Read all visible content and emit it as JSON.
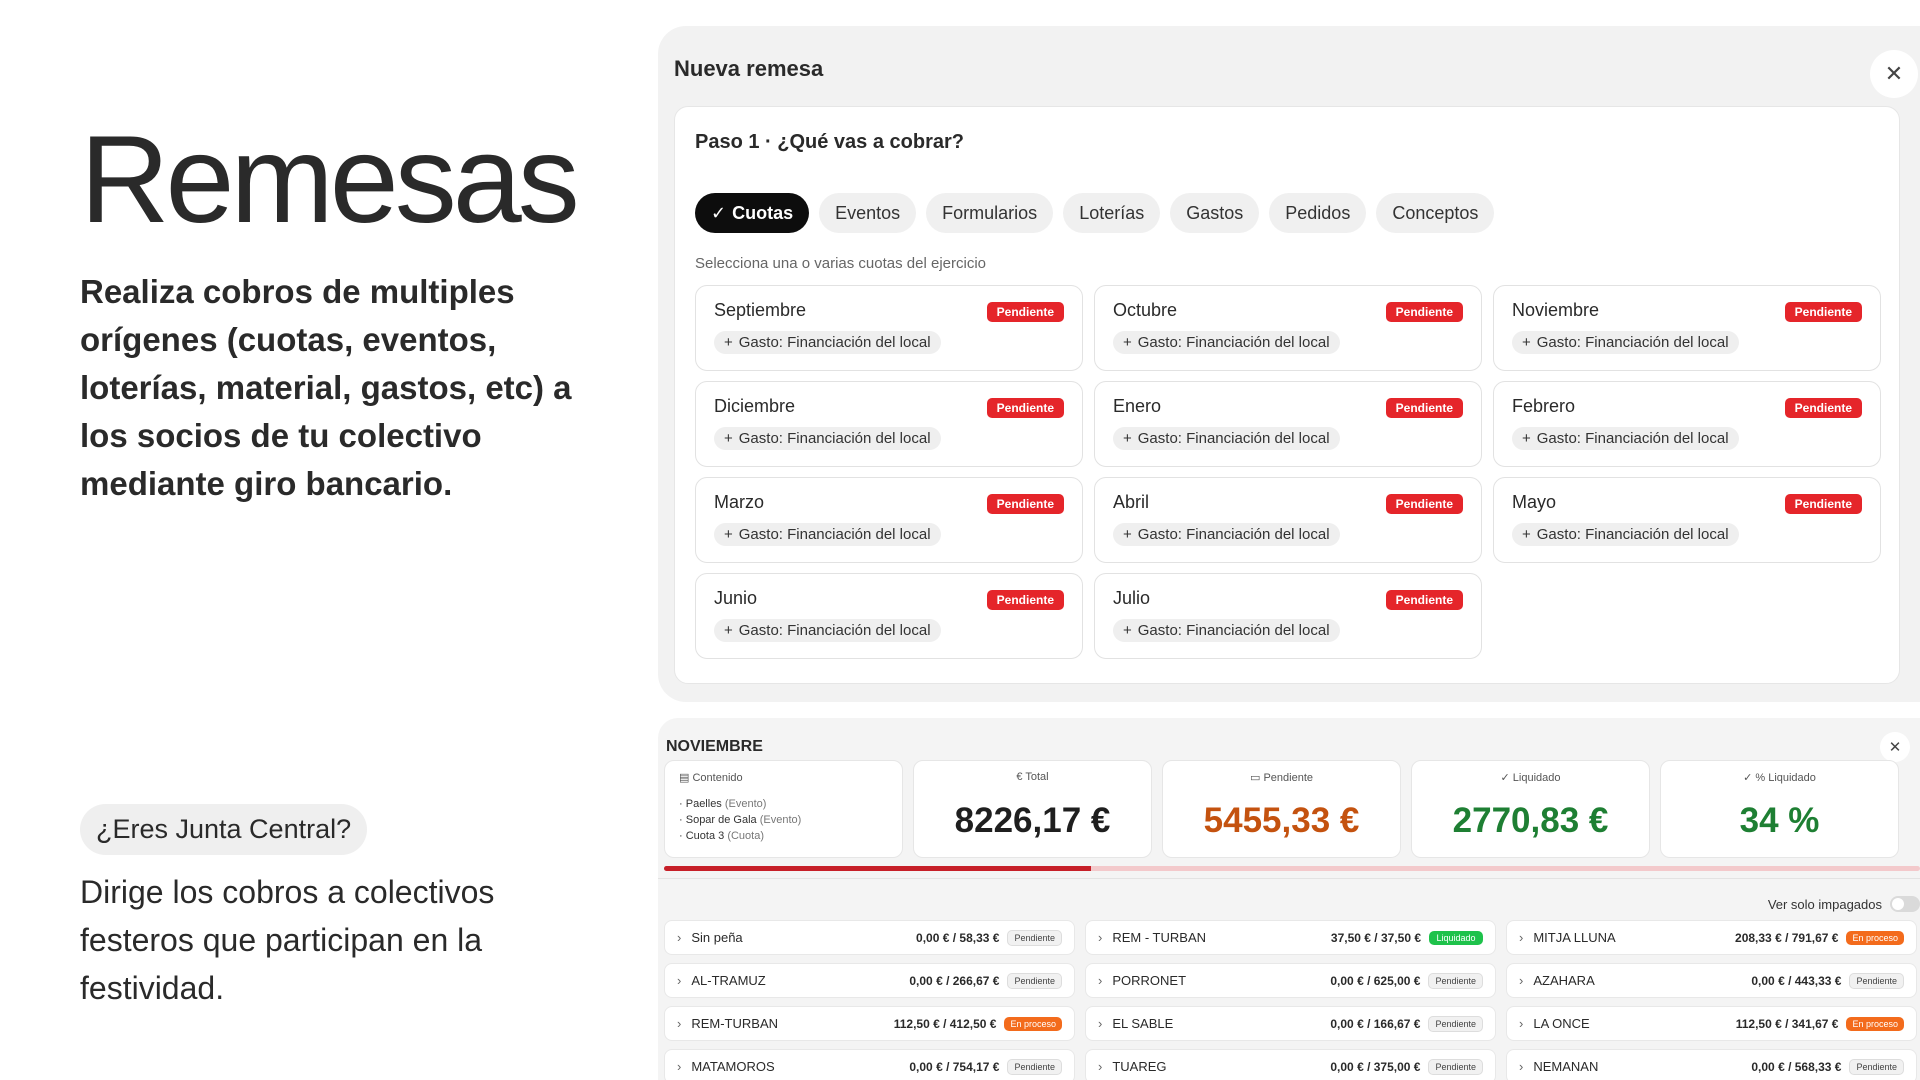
{
  "hero": {
    "title": "Remesas",
    "subtitle": "Realiza cobros de multiples orígenes (cuotas, eventos, loterías, material, gastos, etc) a los socios de tu colectivo mediante giro bancario.",
    "junta_pill": "¿Eres Junta Central?",
    "junta_desc": "Dirige los cobros a colectivos festeros que participan en la festividad."
  },
  "modal": {
    "title": "Nueva remesa",
    "close_icon": "close-icon",
    "step_title": "Paso 1 · ¿Qué vas a cobrar?",
    "tabs": [
      {
        "label": "Cuotas",
        "active": true
      },
      {
        "label": "Eventos",
        "active": false
      },
      {
        "label": "Formularios",
        "active": false
      },
      {
        "label": "Loterías",
        "active": false
      },
      {
        "label": "Gastos",
        "active": false
      },
      {
        "label": "Pedidos",
        "active": false
      },
      {
        "label": "Conceptos",
        "active": false
      }
    ],
    "hint": "Selecciona una o varias cuotas del ejercicio",
    "cuotas": [
      {
        "name": "Septiembre",
        "status": "Pendiente",
        "gasto": "Gasto: Financiación del local"
      },
      {
        "name": "Octubre",
        "status": "Pendiente",
        "gasto": "Gasto: Financiación del local"
      },
      {
        "name": "Noviembre",
        "status": "Pendiente",
        "gasto": "Gasto: Financiación del local"
      },
      {
        "name": "Diciembre",
        "status": "Pendiente",
        "gasto": "Gasto: Financiación del local"
      },
      {
        "name": "Enero",
        "status": "Pendiente",
        "gasto": "Gasto: Financiación del local"
      },
      {
        "name": "Febrero",
        "status": "Pendiente",
        "gasto": "Gasto: Financiación del local"
      },
      {
        "name": "Marzo",
        "status": "Pendiente",
        "gasto": "Gasto: Financiación del local"
      },
      {
        "name": "Abril",
        "status": "Pendiente",
        "gasto": "Gasto: Financiación del local"
      },
      {
        "name": "Mayo",
        "status": "Pendiente",
        "gasto": "Gasto: Financiación del local"
      },
      {
        "name": "Junio",
        "status": "Pendiente",
        "gasto": "Gasto: Financiación del local"
      },
      {
        "name": "Julio",
        "status": "Pendiente",
        "gasto": "Gasto: Financiación del local"
      }
    ]
  },
  "panel": {
    "title": "NOVIEMBRE",
    "contenido": {
      "label": "Contenido",
      "items": [
        {
          "name": "Paelles",
          "tag": "(Evento)"
        },
        {
          "name": "Sopar de Gala",
          "tag": "(Evento)"
        },
        {
          "name": "Cuota 3",
          "tag": "(Cuota)"
        }
      ]
    },
    "stats": [
      {
        "label": "Total",
        "icon": "euro-icon",
        "value": "8226,17 €",
        "color": "#1f1f1f"
      },
      {
        "label": "Pendiente",
        "icon": "calendar-icon",
        "value": "5455,33 €",
        "color": "#c4520f"
      },
      {
        "label": "Liquidado",
        "icon": "check-circle-icon",
        "value": "2770,83 €",
        "color": "#1e7f33"
      },
      {
        "label": "% Liquidado",
        "icon": "check-circle-icon",
        "value": "34 %",
        "color": "#1e7f33"
      }
    ],
    "progress_fraction": 0.34,
    "toggle_label": "Ver solo impagados",
    "groups": [
      {
        "name": "Sin peña",
        "amount": "0,00 € / 58,33 €",
        "status": "Pendiente",
        "kind": "pendiente"
      },
      {
        "name": "REM - TURBAN",
        "amount": "37,50 € / 37,50 €",
        "status": "Liquidado",
        "kind": "liquidado"
      },
      {
        "name": "MITJA LLUNA",
        "amount": "208,33 € / 791,67 €",
        "status": "En proceso",
        "kind": "proceso"
      },
      {
        "name": "AL-TRAMUZ",
        "amount": "0,00 € / 266,67 €",
        "status": "Pendiente",
        "kind": "pendiente"
      },
      {
        "name": "PORRONET",
        "amount": "0,00 € / 625,00 €",
        "status": "Pendiente",
        "kind": "pendiente"
      },
      {
        "name": "AZAHARA",
        "amount": "0,00 € / 443,33 €",
        "status": "Pendiente",
        "kind": "pendiente"
      },
      {
        "name": "REM-TURBAN",
        "amount": "112,50 € / 412,50 €",
        "status": "En proceso",
        "kind": "proceso"
      },
      {
        "name": "EL SABLE",
        "amount": "0,00 € / 166,67 €",
        "status": "Pendiente",
        "kind": "pendiente"
      },
      {
        "name": "LA ONCE",
        "amount": "112,50 € / 341,67 €",
        "status": "En proceso",
        "kind": "proceso"
      },
      {
        "name": "MATAMOROS",
        "amount": "0,00 € / 754,17 €",
        "status": "Pendiente",
        "kind": "pendiente"
      },
      {
        "name": "TUAREG",
        "amount": "0,00 € / 375,00 €",
        "status": "Pendiente",
        "kind": "pendiente"
      },
      {
        "name": "NEMANAN",
        "amount": "0,00 € / 568,33 €",
        "status": "Pendiente",
        "kind": "pendiente"
      }
    ]
  }
}
